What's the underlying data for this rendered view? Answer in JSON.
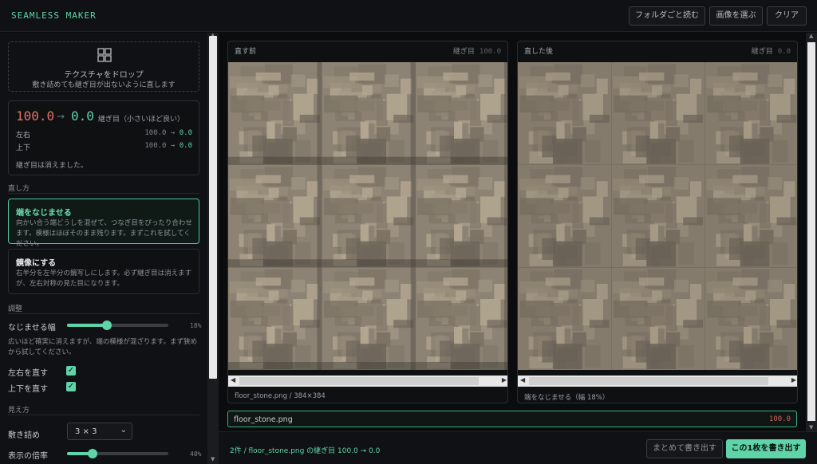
{
  "app": {
    "brand": "SEAMLESS MAKER"
  },
  "toolbar": {
    "open_folder": "フォルダごと読む",
    "choose_image": "画像を選ぶ",
    "clear": "クリア"
  },
  "dropzone": {
    "icon": "grid-icon",
    "title": "テクスチャをドロップ",
    "subtitle": "敷き詰めても継ぎ目が出ないように直します"
  },
  "score": {
    "before": "100.0",
    "arrow": "→",
    "after": "0.0",
    "caption": "継ぎ目（小さいほど良い）",
    "rows": [
      {
        "label": "左右",
        "before": "100.0",
        "after": "0.0"
      },
      {
        "label": "上下",
        "before": "100.0",
        "after": "0.0"
      }
    ],
    "message": "継ぎ目は消えました。"
  },
  "method": {
    "heading": "直し方",
    "options": [
      {
        "title": "端をなじませる",
        "desc": "向かい合う端どうしを混ぜて、つなぎ目をぴったり合わせます。模様はほぼそのまま残ります。まずこれを試してください。",
        "selected": true
      },
      {
        "title": "鏡像にする",
        "desc": "右半分を左半分の鏡写しにします。必ず継ぎ目は消えますが、左右対称の見た目になります。",
        "selected": false
      }
    ]
  },
  "adjust": {
    "heading": "調整",
    "blend_label": "なじませる幅",
    "blend_value": "18%",
    "blend_fraction": 0.18,
    "help": "広いほど確実に消えますが、端の模様が混ざります。まず狭めから試してください。",
    "fix_lr_label": "左右を直す",
    "fix_lr": true,
    "fix_ud_label": "上下を直す",
    "fix_ud": true
  },
  "view": {
    "heading": "見え方",
    "tile_label": "敷き詰め",
    "tile_value": "3 × 3",
    "zoom_label": "表示の倍率",
    "zoom_value": "40%",
    "zoom_fraction": 0.4
  },
  "panels": {
    "before": {
      "title": "直す前",
      "seam_label": "継ぎ目",
      "seam_value": "100.0",
      "footer": "floor_stone.png / 384×384"
    },
    "after": {
      "title": "直した後",
      "seam_label": "継ぎ目",
      "seam_value": "0.0",
      "footer": "端をなじませる（幅 18%）"
    }
  },
  "files": [
    {
      "name": "floor_stone.png",
      "score": "100.0"
    }
  ],
  "bottom": {
    "status": "2件 / floor_stone.png の継ぎ目 100.0 → 0.0",
    "export_all": "まとめて書き出す",
    "export_one": "この1枚を書き出す"
  },
  "colors": {
    "accent": "#5fd4a8",
    "bad": "#e07468"
  }
}
